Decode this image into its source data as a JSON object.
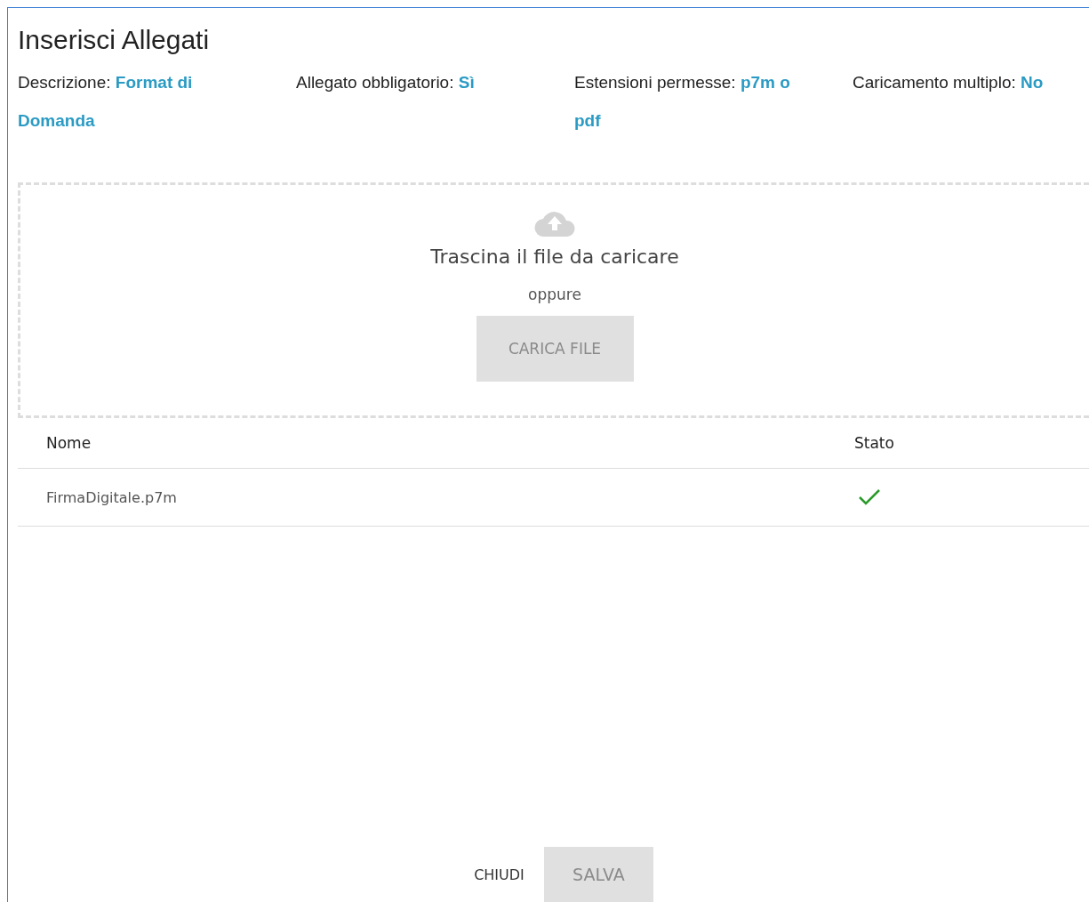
{
  "dialog": {
    "title": "Inserisci Allegati"
  },
  "info": [
    {
      "label": "Descrizione:",
      "value": "Format di Domanda"
    },
    {
      "label": "Allegato obbligatorio:",
      "value": "Sì"
    },
    {
      "label": "Estensioni permesse:",
      "value": "p7m o pdf"
    },
    {
      "label": "Caricamento multiplo:",
      "value": "No"
    }
  ],
  "dropzone": {
    "text": "Trascina il file da caricare",
    "or": "oppure",
    "button": {
      "label": "CARICA FILE",
      "disabled": true
    }
  },
  "table": {
    "columns": [
      "Nome",
      "Stato"
    ],
    "rows": [
      {
        "name": "FirmaDigitale.p7m",
        "uploaded": true
      }
    ]
  },
  "footer": {
    "buttons": [
      {
        "label": "CHIUDI",
        "kind": "text",
        "disabled": false
      },
      {
        "label": "SALVA",
        "kind": "filled",
        "disabled": true
      }
    ]
  }
}
